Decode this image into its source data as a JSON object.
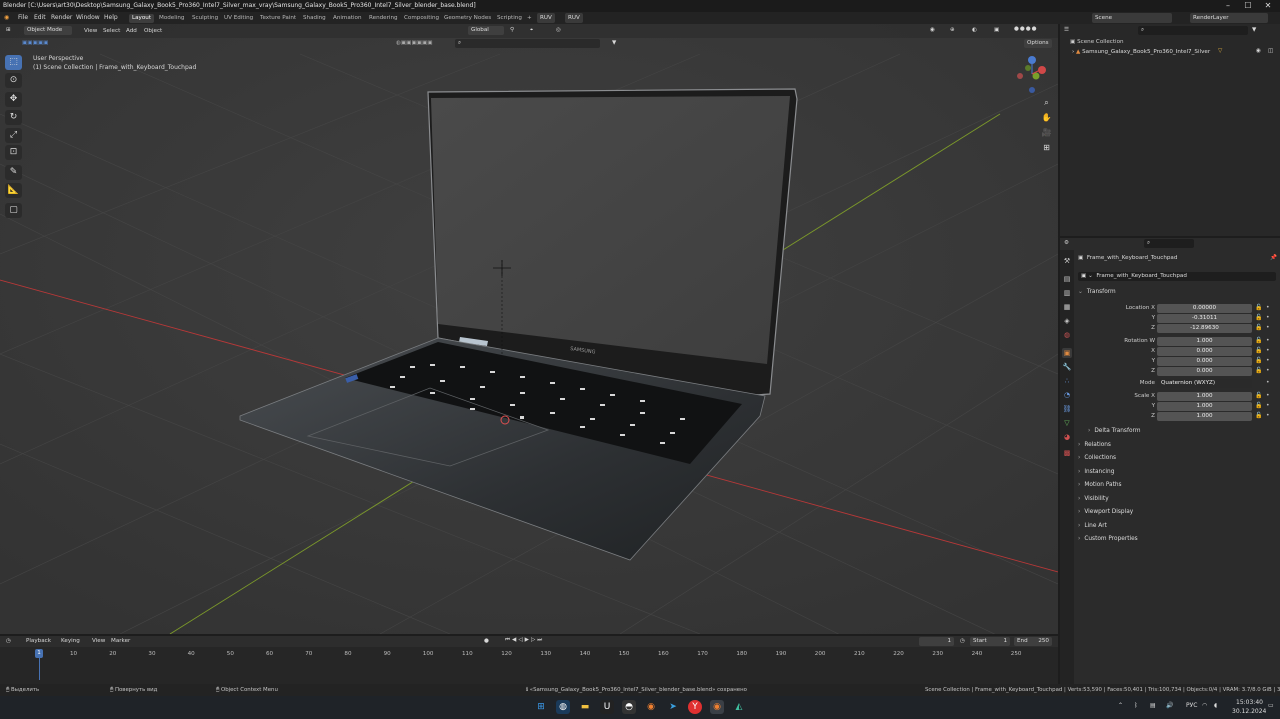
{
  "window": {
    "title": "Blender [C:\\Users\\art30\\Desktop\\Samsung_Galaxy_Book5_Pro360_Intel7_Silver_max_vray\\Samsung_Galaxy_Book5_Pro360_Intel7_Silver_blender_base.blend]",
    "minimize": "–",
    "maximize": "☐",
    "close": "✕"
  },
  "menu": {
    "items": [
      "File",
      "Edit",
      "Render",
      "Window",
      "Help"
    ],
    "workspaces": [
      "Layout",
      "Modeling",
      "Sculpting",
      "UV Editing",
      "Texture Paint",
      "Shading",
      "Animation",
      "Rendering",
      "Compositing",
      "Geometry Nodes",
      "Scripting"
    ],
    "add_tab": "+",
    "lang_chip_1": "RUV",
    "lang_chip_2": "RUV",
    "scene_label": "Scene",
    "render_layer_label": "RenderLayer"
  },
  "viewport": {
    "mode": "Object Mode",
    "header_menus": [
      "View",
      "Select",
      "Add",
      "Object"
    ],
    "transform_orientation": "Global",
    "options": "Options",
    "overlay_title": "User Perspective",
    "overlay_subtitle": "(1) Scene Collection | Frame_with_Keyboard_Touchpad",
    "laptop_brand": "SAMSUNG"
  },
  "outliner": {
    "root": "Scene Collection",
    "item": "Samsung_Galaxy_Book5_Pro360_Intel7_Silver"
  },
  "properties": {
    "object_name": "Frame_with_Keyboard_Touchpad",
    "data_name": "Frame_with_Keyboard_Touchpad",
    "transform_header": "Transform",
    "location_x_label": "Location X",
    "location_x": "0.00000",
    "location_y_label": "Y",
    "location_y": "-0.31011",
    "location_z_label": "Z",
    "location_z": "-12.89630",
    "rotation_w_label": "Rotation W",
    "rotation_w": "1.000",
    "rotation_x_label": "X",
    "rotation_x": "0.000",
    "rotation_y_label": "Y",
    "rotation_y": "0.000",
    "rotation_z_label": "Z",
    "rotation_z": "0.000",
    "mode_label": "Mode",
    "mode_value": "Quaternion (WXYZ)",
    "scale_x_label": "Scale X",
    "scale_x": "1.000",
    "scale_y_label": "Y",
    "scale_y": "1.000",
    "scale_z_label": "Z",
    "scale_z": "1.000",
    "delta_transform": "Delta Transform",
    "panels": [
      "Relations",
      "Collections",
      "Instancing",
      "Motion Paths",
      "Visibility",
      "Viewport Display",
      "Line Art",
      "Custom Properties"
    ]
  },
  "timeline": {
    "menus": [
      "Playback",
      "Keying",
      "View",
      "Marker"
    ],
    "current_frame": "1",
    "start_label": "Start",
    "start": "1",
    "end_label": "End",
    "end": "250",
    "ticks": [
      "10",
      "20",
      "30",
      "40",
      "50",
      "60",
      "70",
      "80",
      "90",
      "100",
      "110",
      "120",
      "130",
      "140",
      "150",
      "160",
      "170",
      "180",
      "190",
      "200",
      "210",
      "220",
      "230",
      "240",
      "250"
    ],
    "playhead_label": "1"
  },
  "status": {
    "left_1": "Выделить",
    "left_2": "Повернуть вид",
    "left_3": "Object Context Menu",
    "message": "«Samsung_Galaxy_Book5_Pro360_Intel7_Silver_blender_base.blend» сохранено",
    "stats": "Scene Collection | Frame_with_Keyboard_Touchpad | Verts:53,590 | Faces:50,401 | Tris:100,734 | Objects:0/4 | VRAM: 3.7/8.0 GiB | 3.6.11"
  },
  "taskbar": {
    "lang": "РУС",
    "time": "15:03:40",
    "date": "30.12.2024"
  },
  "colors": {
    "accent": "#4772b3",
    "viewport_bg": "#3a3a3a",
    "axis_x": "#c23b3b",
    "axis_y": "#7fa02a"
  }
}
